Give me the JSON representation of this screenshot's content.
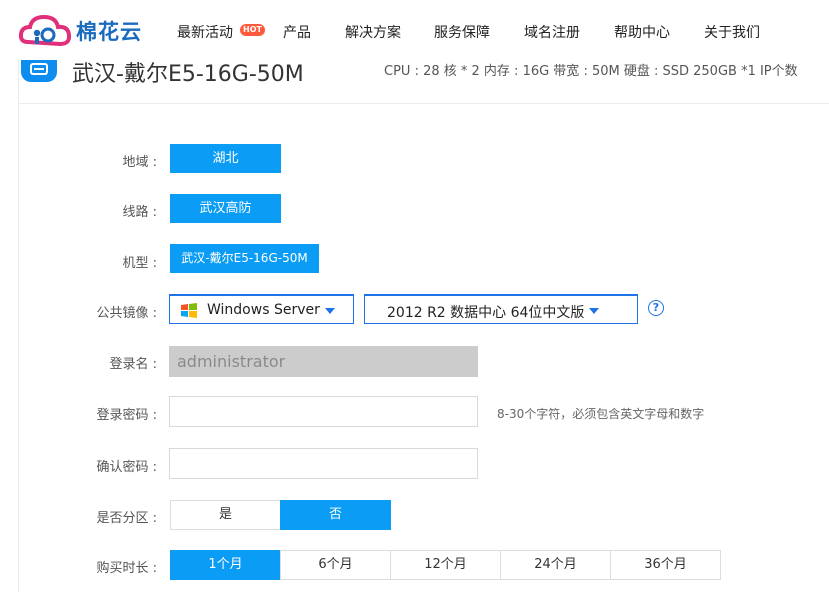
{
  "nav": {
    "brand": "棉花云",
    "items": [
      "最新活动",
      "产品",
      "解决方案",
      "服务保障",
      "域名注册",
      "帮助中心",
      "关于我们"
    ],
    "hot_badge": "HOT"
  },
  "product": {
    "title": "武汉-戴尔E5-16G-50M",
    "specs": "CPU : 28 核 * 2   内存 : 16G   带宽 : 50M   硬盘 : SSD 250GB *1   IP个数"
  },
  "form": {
    "region": {
      "label": "地域 :",
      "value": "湖北"
    },
    "line": {
      "label": "线路 :",
      "value": "武汉高防"
    },
    "model": {
      "label": "机型 :",
      "value": "武汉-戴尔E5-16G-50M"
    },
    "image": {
      "label": "公共镜像 :",
      "os": "Windows Server",
      "version": "2012 R2 数据中心 64位中文版",
      "help": "?"
    },
    "login_name": {
      "label": "登录名 :",
      "value": "administrator"
    },
    "login_password": {
      "label": "登录密码 :",
      "value": "",
      "hint": "8-30个字符，必须包含英文字母和数字"
    },
    "confirm_password": {
      "label": "确认密码 :",
      "value": ""
    },
    "partition": {
      "label": "是否分区 :",
      "options": [
        "是",
        "否"
      ],
      "selected": "否"
    },
    "duration": {
      "label": "购买时长 :",
      "options": [
        "1个月",
        "6个月",
        "12个月",
        "24个月",
        "36个月"
      ],
      "selected": "1个月"
    }
  },
  "colors": {
    "accent": "#0b9cf5",
    "brand": "#1a6bbd",
    "select_border": "#1e73e8"
  }
}
